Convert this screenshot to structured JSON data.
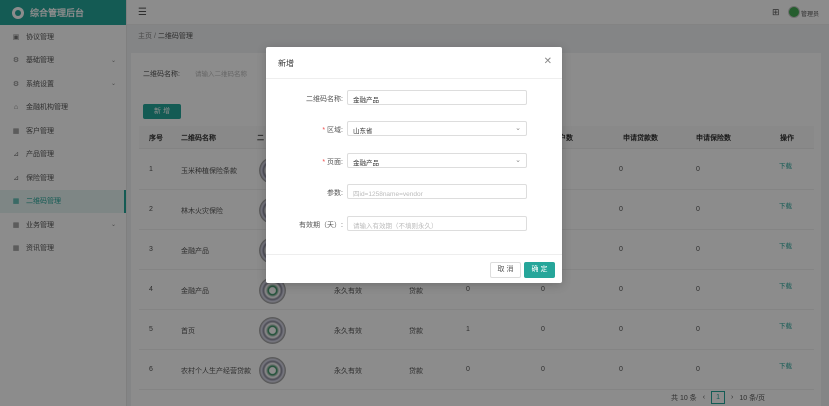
{
  "brand": {
    "title": "综合管理后台"
  },
  "sidebar": {
    "items": [
      {
        "icon": "document-icon",
        "glyph": "▣",
        "label": "协议管理",
        "has_arrow": false,
        "active": false
      },
      {
        "icon": "gear-icon",
        "glyph": "⚙",
        "label": "基础管理",
        "has_arrow": true,
        "active": false
      },
      {
        "icon": "gear-icon",
        "glyph": "⚙",
        "label": "系统设置",
        "has_arrow": true,
        "active": false
      },
      {
        "icon": "bank-icon",
        "glyph": "⌂",
        "label": "金融机构管理",
        "has_arrow": false,
        "active": false
      },
      {
        "icon": "users-icon",
        "glyph": "▦",
        "label": "客户管理",
        "has_arrow": false,
        "active": false
      },
      {
        "icon": "product-icon",
        "glyph": "⊿",
        "label": "产品管理",
        "has_arrow": false,
        "active": false
      },
      {
        "icon": "insurance-icon",
        "glyph": "⊿",
        "label": "保险管理",
        "has_arrow": false,
        "active": false
      },
      {
        "icon": "qrcode-icon",
        "glyph": "▦",
        "label": "二维码管理",
        "has_arrow": false,
        "active": true
      },
      {
        "icon": "business-icon",
        "glyph": "▦",
        "label": "业务管理",
        "has_arrow": true,
        "active": false
      },
      {
        "icon": "news-icon",
        "glyph": "▦",
        "label": "资讯管理",
        "has_arrow": false,
        "active": false
      }
    ]
  },
  "header": {
    "user": "管理员"
  },
  "breadcrumb": {
    "home": "主页",
    "sep": "/",
    "current": "二维码管理"
  },
  "filter": {
    "label": "二维码名称:",
    "placeholder": "请输入二维码名称"
  },
  "toolbar": {
    "add_label": "新 增"
  },
  "table": {
    "columns": [
      "序号",
      "二维码名称",
      "二",
      "",
      "",
      "户数",
      "申请贷款数",
      "申请保险数",
      "操作"
    ],
    "rows": [
      {
        "index": "1",
        "name": "玉米种植保险条款",
        "validity": "",
        "type": "",
        "c1": "",
        "c2": "",
        "loans": "0",
        "insurance": "0",
        "op": "下载"
      },
      {
        "index": "2",
        "name": "林木火灾保险",
        "validity": "",
        "type": "",
        "c1": "",
        "c2": "",
        "loans": "0",
        "insurance": "0",
        "op": "下载"
      },
      {
        "index": "3",
        "name": "金融产品",
        "validity": "",
        "type": "",
        "c1": "",
        "c2": "",
        "loans": "0",
        "insurance": "0",
        "op": "下载"
      },
      {
        "index": "4",
        "name": "金融产品",
        "validity": "永久有效",
        "type": "贷款",
        "c1": "0",
        "c2": "0",
        "loans": "0",
        "insurance": "0",
        "op": "下载"
      },
      {
        "index": "5",
        "name": "首页",
        "validity": "永久有效",
        "type": "贷款",
        "c1": "1",
        "c2": "0",
        "loans": "0",
        "insurance": "0",
        "op": "下载"
      },
      {
        "index": "6",
        "name": "农村个人生产经营贷款",
        "validity": "永久有效",
        "type": "贷款",
        "c1": "0",
        "c2": "0",
        "loans": "0",
        "insurance": "0",
        "op": "下载"
      }
    ]
  },
  "pagination": {
    "total": "共 10 条",
    "prev": "‹",
    "current": "1",
    "next": "›",
    "page_size": "10 条/页"
  },
  "modal": {
    "title": "新增",
    "fields": {
      "name_label": "二维码名称:",
      "name_value": "金融产品",
      "region_label": "区域:",
      "region_value": "山东省",
      "page_label": "页面:",
      "page_value": "金融产品",
      "params_label": "参数:",
      "params_placeholder": "四id=1258name=vendor",
      "validity_label": "有效期（天）:",
      "validity_placeholder": "请输入有效期（不填则永久）"
    },
    "cancel_label": "取 消",
    "ok_label": "确 定"
  },
  "colors": {
    "accent": "#26a69a",
    "required": "#f04848"
  }
}
